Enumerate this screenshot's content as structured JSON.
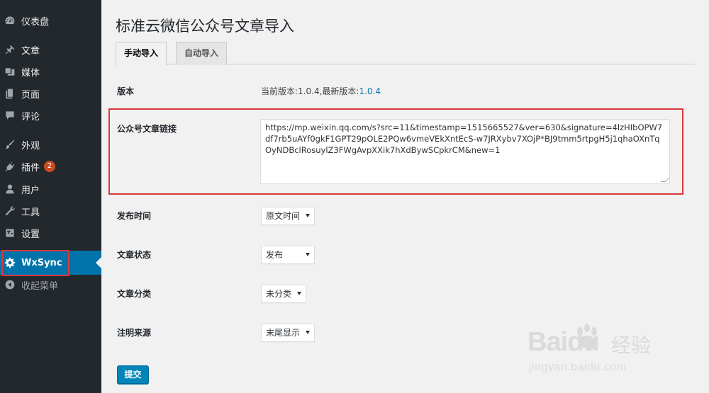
{
  "sidebar": {
    "items": [
      {
        "label": "仪表盘",
        "icon": "dashboard-icon"
      },
      {
        "label": "文章",
        "icon": "pin-icon"
      },
      {
        "label": "媒体",
        "icon": "media-icon"
      },
      {
        "label": "页面",
        "icon": "page-icon"
      },
      {
        "label": "评论",
        "icon": "comment-icon"
      },
      {
        "label": "外观",
        "icon": "brush-icon"
      },
      {
        "label": "插件",
        "icon": "plugin-icon",
        "badge": "2"
      },
      {
        "label": "用户",
        "icon": "user-icon"
      },
      {
        "label": "工具",
        "icon": "wrench-icon"
      },
      {
        "label": "设置",
        "icon": "settings-icon"
      },
      {
        "label": "WxSync",
        "icon": "gear-icon",
        "active": true
      },
      {
        "label": "收起菜单",
        "icon": "collapse-icon"
      }
    ]
  },
  "page": {
    "title": "标准云微信公众号文章导入",
    "tabs": [
      {
        "label": "手动导入",
        "active": true
      },
      {
        "label": "自动导入",
        "active": false
      }
    ]
  },
  "form": {
    "version": {
      "label": "版本",
      "text": "当前版本:1.0.4,最新版本:",
      "link": "1.0.4"
    },
    "url": {
      "label": "公众号文章链接",
      "value": "https://mp.weixin.qq.com/s?src=11&timestamp=1515665527&ver=630&signature=4lzHIbOPW7df7rb5uAYf0gkF1GPT29pOLE2PQw6vmeVEkXntEcS-w7JRXybv7XOjP*BJ9tmm5rtpgH5j1qhaOXnTqOyNDBclRosuylZ3FWgAvpXXik7hXdBywSCpkrCM&new=1"
    },
    "publish_time": {
      "label": "发布时间",
      "selected": "原文时间"
    },
    "status": {
      "label": "文章状态",
      "selected": "发布"
    },
    "category": {
      "label": "文章分类",
      "selected": "未分类"
    },
    "source": {
      "label": "注明来源",
      "selected": "末尾显示"
    },
    "submit_label": "提交"
  },
  "watermark": {
    "brand": "Baidu",
    "cn": "经验",
    "url": "jingyan.baidu.com"
  },
  "colors": {
    "sidebar_bg": "#23282d",
    "active_bg": "#0073aa",
    "highlight_red": "#d9373c",
    "button_blue": "#0085ba",
    "badge_orange": "#ca4a1f",
    "link_blue": "#0073aa"
  }
}
